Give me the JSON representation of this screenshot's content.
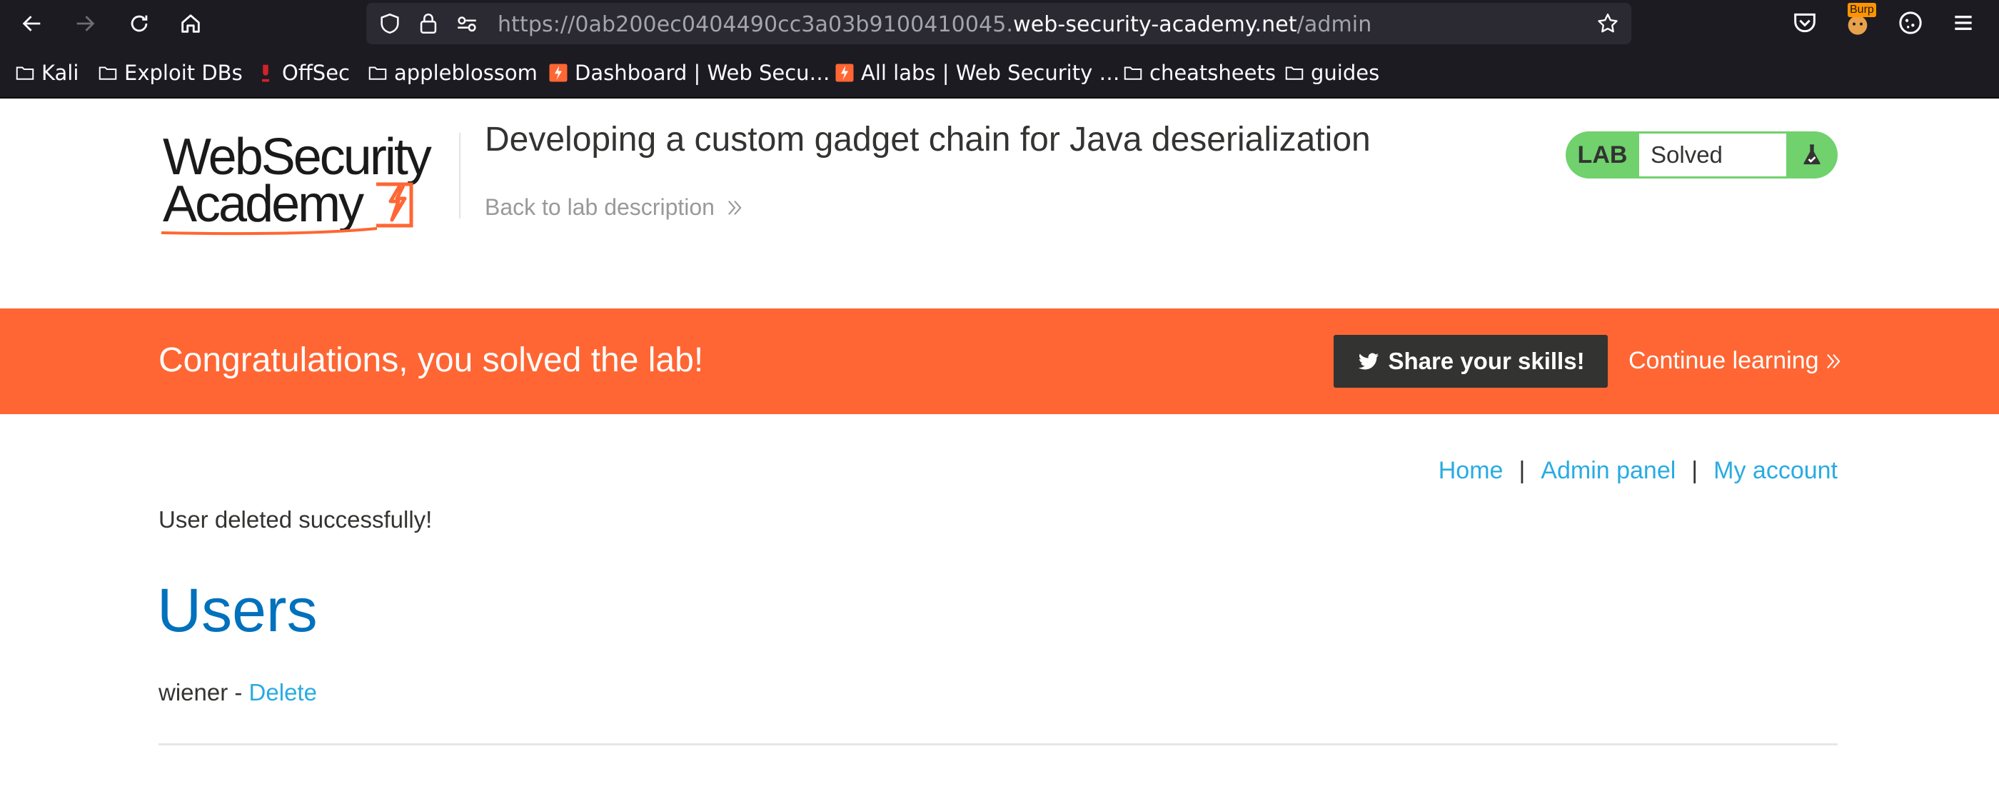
{
  "browser": {
    "url_prefix": "https://0ab200ec0404490cc3a03b9100410045.",
    "url_host": "web-security-academy.net",
    "url_path": "/admin",
    "extension_badge": "Burp"
  },
  "bookmarks": [
    {
      "label": "Kali",
      "icon": "folder-icon"
    },
    {
      "label": "Exploit DBs",
      "icon": "folder-icon"
    },
    {
      "label": "OffSec",
      "icon": "offsec-icon"
    },
    {
      "label": "appleblossom",
      "icon": "folder-icon"
    },
    {
      "label": "Dashboard | Web Secu…",
      "icon": "portswigger-icon"
    },
    {
      "label": "All labs | Web Security …",
      "icon": "portswigger-icon"
    },
    {
      "label": "cheatsheets",
      "icon": "folder-icon"
    },
    {
      "label": "guides",
      "icon": "folder-icon"
    }
  ],
  "header": {
    "logo_line1": "WebSecurity",
    "logo_line2": "Academy",
    "lab_title": "Developing a custom gadget chain for Java deserialization",
    "back_link": "Back to lab description",
    "lab_tag": "LAB",
    "lab_status": "Solved"
  },
  "banner": {
    "message": "Congratulations, you solved the lab!",
    "share_label": "Share your skills!",
    "continue_label": "Continue learning"
  },
  "nav": {
    "home": "Home",
    "admin": "Admin panel",
    "account": "My account",
    "separator": "|"
  },
  "main": {
    "message": "User deleted successfully!",
    "heading": "Users",
    "users": [
      {
        "name": "wiener",
        "dash": " - ",
        "action": "Delete"
      }
    ]
  },
  "colors": {
    "accent_orange": "#ff6633",
    "solved_green": "#70d16d",
    "link_blue": "#29abe2",
    "heading_blue": "#0071bc"
  }
}
